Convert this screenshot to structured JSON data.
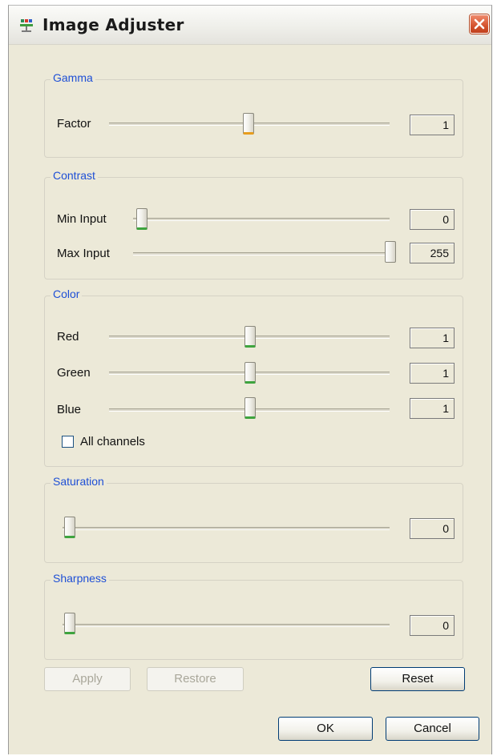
{
  "window": {
    "title": "Image Adjuster"
  },
  "groups": {
    "gamma": {
      "label": "Gamma",
      "rows": [
        {
          "label": "Factor",
          "value": "1",
          "slider_fraction": 0.5
        }
      ]
    },
    "contrast": {
      "label": "Contrast",
      "rows": [
        {
          "label": "Min Input",
          "value": "0",
          "slider_fraction": 0.0
        },
        {
          "label": "Max Input",
          "value": "255",
          "slider_fraction": 1.0
        }
      ]
    },
    "color": {
      "label": "Color",
      "rows": [
        {
          "label": "Red",
          "value": "1",
          "slider_fraction": 0.5
        },
        {
          "label": "Green",
          "value": "1",
          "slider_fraction": 0.5
        },
        {
          "label": "Blue",
          "value": "1",
          "slider_fraction": 0.5
        }
      ],
      "all_channels": {
        "label": "All channels",
        "checked": false
      }
    },
    "saturation": {
      "label": "Saturation",
      "value": "0",
      "slider_fraction": 0.0
    },
    "sharpness": {
      "label": "Sharpness",
      "value": "0",
      "slider_fraction": 0.0
    }
  },
  "buttons": {
    "apply": {
      "label": "Apply",
      "enabled": false
    },
    "restore": {
      "label": "Restore",
      "enabled": false
    },
    "reset": {
      "label": "Reset",
      "enabled": true
    },
    "ok": {
      "label": "OK",
      "enabled": true
    },
    "cancel": {
      "label": "Cancel",
      "enabled": true
    }
  },
  "icons": {
    "app": "image-adjuster-app-icon",
    "close": "close-icon"
  },
  "colors": {
    "group_label": "#1e4fd6",
    "close_button": "#d4532f",
    "thumb_accent_green": "#3ea43e",
    "thumb_accent_orange": "#e79d1d"
  }
}
